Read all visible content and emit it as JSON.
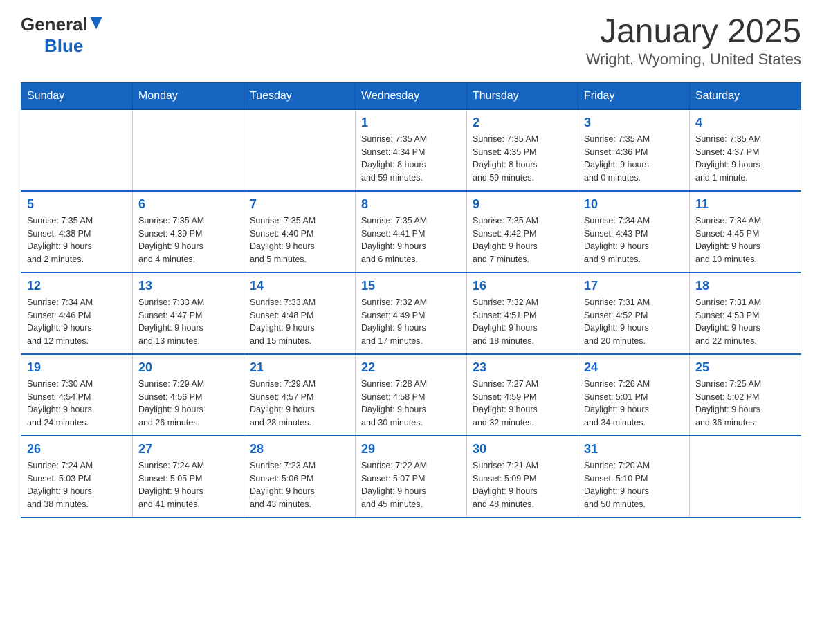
{
  "header": {
    "logo_general": "General",
    "logo_blue": "Blue",
    "title": "January 2025",
    "subtitle": "Wright, Wyoming, United States"
  },
  "days_of_week": [
    "Sunday",
    "Monday",
    "Tuesday",
    "Wednesday",
    "Thursday",
    "Friday",
    "Saturday"
  ],
  "weeks": [
    [
      {
        "day": "",
        "info": ""
      },
      {
        "day": "",
        "info": ""
      },
      {
        "day": "",
        "info": ""
      },
      {
        "day": "1",
        "info": "Sunrise: 7:35 AM\nSunset: 4:34 PM\nDaylight: 8 hours\nand 59 minutes."
      },
      {
        "day": "2",
        "info": "Sunrise: 7:35 AM\nSunset: 4:35 PM\nDaylight: 8 hours\nand 59 minutes."
      },
      {
        "day": "3",
        "info": "Sunrise: 7:35 AM\nSunset: 4:36 PM\nDaylight: 9 hours\nand 0 minutes."
      },
      {
        "day": "4",
        "info": "Sunrise: 7:35 AM\nSunset: 4:37 PM\nDaylight: 9 hours\nand 1 minute."
      }
    ],
    [
      {
        "day": "5",
        "info": "Sunrise: 7:35 AM\nSunset: 4:38 PM\nDaylight: 9 hours\nand 2 minutes."
      },
      {
        "day": "6",
        "info": "Sunrise: 7:35 AM\nSunset: 4:39 PM\nDaylight: 9 hours\nand 4 minutes."
      },
      {
        "day": "7",
        "info": "Sunrise: 7:35 AM\nSunset: 4:40 PM\nDaylight: 9 hours\nand 5 minutes."
      },
      {
        "day": "8",
        "info": "Sunrise: 7:35 AM\nSunset: 4:41 PM\nDaylight: 9 hours\nand 6 minutes."
      },
      {
        "day": "9",
        "info": "Sunrise: 7:35 AM\nSunset: 4:42 PM\nDaylight: 9 hours\nand 7 minutes."
      },
      {
        "day": "10",
        "info": "Sunrise: 7:34 AM\nSunset: 4:43 PM\nDaylight: 9 hours\nand 9 minutes."
      },
      {
        "day": "11",
        "info": "Sunrise: 7:34 AM\nSunset: 4:45 PM\nDaylight: 9 hours\nand 10 minutes."
      }
    ],
    [
      {
        "day": "12",
        "info": "Sunrise: 7:34 AM\nSunset: 4:46 PM\nDaylight: 9 hours\nand 12 minutes."
      },
      {
        "day": "13",
        "info": "Sunrise: 7:33 AM\nSunset: 4:47 PM\nDaylight: 9 hours\nand 13 minutes."
      },
      {
        "day": "14",
        "info": "Sunrise: 7:33 AM\nSunset: 4:48 PM\nDaylight: 9 hours\nand 15 minutes."
      },
      {
        "day": "15",
        "info": "Sunrise: 7:32 AM\nSunset: 4:49 PM\nDaylight: 9 hours\nand 17 minutes."
      },
      {
        "day": "16",
        "info": "Sunrise: 7:32 AM\nSunset: 4:51 PM\nDaylight: 9 hours\nand 18 minutes."
      },
      {
        "day": "17",
        "info": "Sunrise: 7:31 AM\nSunset: 4:52 PM\nDaylight: 9 hours\nand 20 minutes."
      },
      {
        "day": "18",
        "info": "Sunrise: 7:31 AM\nSunset: 4:53 PM\nDaylight: 9 hours\nand 22 minutes."
      }
    ],
    [
      {
        "day": "19",
        "info": "Sunrise: 7:30 AM\nSunset: 4:54 PM\nDaylight: 9 hours\nand 24 minutes."
      },
      {
        "day": "20",
        "info": "Sunrise: 7:29 AM\nSunset: 4:56 PM\nDaylight: 9 hours\nand 26 minutes."
      },
      {
        "day": "21",
        "info": "Sunrise: 7:29 AM\nSunset: 4:57 PM\nDaylight: 9 hours\nand 28 minutes."
      },
      {
        "day": "22",
        "info": "Sunrise: 7:28 AM\nSunset: 4:58 PM\nDaylight: 9 hours\nand 30 minutes."
      },
      {
        "day": "23",
        "info": "Sunrise: 7:27 AM\nSunset: 4:59 PM\nDaylight: 9 hours\nand 32 minutes."
      },
      {
        "day": "24",
        "info": "Sunrise: 7:26 AM\nSunset: 5:01 PM\nDaylight: 9 hours\nand 34 minutes."
      },
      {
        "day": "25",
        "info": "Sunrise: 7:25 AM\nSunset: 5:02 PM\nDaylight: 9 hours\nand 36 minutes."
      }
    ],
    [
      {
        "day": "26",
        "info": "Sunrise: 7:24 AM\nSunset: 5:03 PM\nDaylight: 9 hours\nand 38 minutes."
      },
      {
        "day": "27",
        "info": "Sunrise: 7:24 AM\nSunset: 5:05 PM\nDaylight: 9 hours\nand 41 minutes."
      },
      {
        "day": "28",
        "info": "Sunrise: 7:23 AM\nSunset: 5:06 PM\nDaylight: 9 hours\nand 43 minutes."
      },
      {
        "day": "29",
        "info": "Sunrise: 7:22 AM\nSunset: 5:07 PM\nDaylight: 9 hours\nand 45 minutes."
      },
      {
        "day": "30",
        "info": "Sunrise: 7:21 AM\nSunset: 5:09 PM\nDaylight: 9 hours\nand 48 minutes."
      },
      {
        "day": "31",
        "info": "Sunrise: 7:20 AM\nSunset: 5:10 PM\nDaylight: 9 hours\nand 50 minutes."
      },
      {
        "day": "",
        "info": ""
      }
    ]
  ]
}
